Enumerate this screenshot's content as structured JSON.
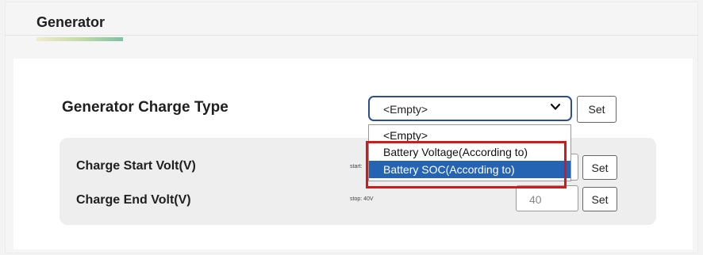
{
  "section": {
    "title": "Generator"
  },
  "generator_charge_type": {
    "label": "Generator Charge Type",
    "selected_value": "<Empty>",
    "set_label": "Set",
    "options": [
      "<Empty>",
      "Battery Voltage(According to)",
      "Battery SOC(According to)"
    ],
    "highlighted_option_index": 2
  },
  "charge_start": {
    "label": "Charge Start Volt(V)",
    "hint": "start:",
    "set_label": "Set"
  },
  "charge_end": {
    "label": "Charge End Volt(V)",
    "hint": "stop: 40V",
    "value": "40",
    "set_label": "Set"
  },
  "colors": {
    "select_border": "#2d4f8a",
    "option_highlight": "#2563b3",
    "annotation_red": "#d11a1a"
  }
}
